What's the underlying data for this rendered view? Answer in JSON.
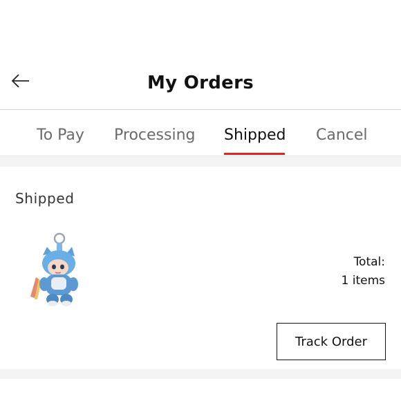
{
  "header": {
    "title": "My Orders",
    "back_icon": "arrow-left-icon"
  },
  "tabs": [
    {
      "label": "To Pay",
      "active": false
    },
    {
      "label": "Processing",
      "active": false
    },
    {
      "label": "Shipped",
      "active": true
    },
    {
      "label": "Cancel",
      "active": false
    }
  ],
  "colors": {
    "accent": "#e02222",
    "tab_inactive": "#6a6a6a",
    "tab_active": "#111111",
    "band": "#f3f3f3"
  },
  "order": {
    "status": "Shipped",
    "total_label": "Total:",
    "items_count": "1 items",
    "product_image": "blue-cat-doll-keychain",
    "track_button": "Track Order"
  }
}
